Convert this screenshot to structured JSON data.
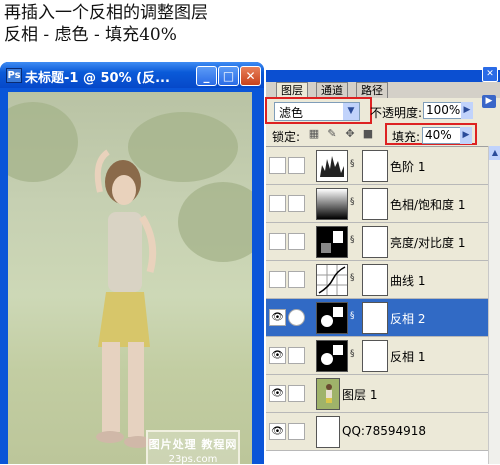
{
  "caption": {
    "line1": "再插入一个反相的调整图层",
    "line2": "反相 - 虑色 - 填充40%"
  },
  "document": {
    "title": "未标题-1 @ 50% (反...",
    "minimize_glyph": "_",
    "maximize_glyph": "□",
    "close_glyph": "✕",
    "watermark_line1": "图片处理 教程网",
    "watermark_line2": "23ps.com"
  },
  "panel": {
    "tabs": [
      "图层",
      "通道",
      "路径"
    ],
    "blend_mode": "滤色",
    "opacity_label": "不透明度:",
    "opacity_value": "100%",
    "lock_label": "锁定:",
    "fill_label": "填充:",
    "fill_value": "40%",
    "layers": [
      {
        "name": "色阶 1",
        "visible": false,
        "thumb": "levels-icon",
        "selected": false
      },
      {
        "name": "色相/饱和度 1",
        "visible": false,
        "thumb": "hue-saturation-icon",
        "selected": false
      },
      {
        "name": "亮度/对比度 1",
        "visible": false,
        "thumb": "brightness-contrast-icon",
        "selected": false
      },
      {
        "name": "曲线 1",
        "visible": false,
        "thumb": "curves-icon",
        "selected": false
      },
      {
        "name": "反相 2",
        "visible": true,
        "thumb": "invert-icon",
        "selected": true
      },
      {
        "name": "反相 1",
        "visible": true,
        "thumb": "invert-icon",
        "selected": false
      },
      {
        "name": "图层 1",
        "visible": true,
        "thumb": "photo-thumbnail",
        "selected": false
      },
      {
        "name": "QQ:78594918",
        "visible": true,
        "thumb": "blank-thumbnail",
        "selected": false
      }
    ]
  },
  "colors": {
    "titlebar": "#0a5ad8",
    "selection": "#316ac5",
    "highlight": "#dd2222"
  }
}
